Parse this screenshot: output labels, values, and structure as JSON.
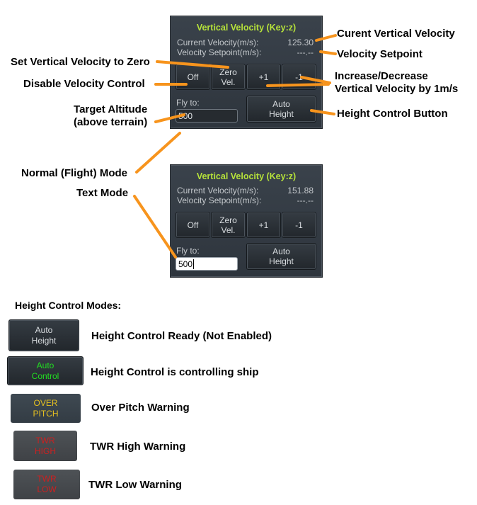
{
  "panel1": {
    "title": "Vertical Velocity (Key:z)",
    "current_velocity_label": "Current Velocity(m/s):",
    "current_velocity_value": "125.30",
    "setpoint_label": "Velocity Setpoint(m/s):",
    "setpoint_value": "---.--",
    "buttons": {
      "off": "Off",
      "zero_line1": "Zero",
      "zero_line2": "Vel.",
      "plus": "+1",
      "minus": "-1"
    },
    "fly_to_label": "Fly to:",
    "fly_to_value": "500",
    "auto_height_line1": "Auto",
    "auto_height_line2": "Height"
  },
  "panel2": {
    "title": "Vertical Velocity (Key:z)",
    "current_velocity_label": "Current Velocity(m/s):",
    "current_velocity_value": "151.88",
    "setpoint_label": "Velocity Setpoint(m/s):",
    "setpoint_value": "---.--",
    "buttons": {
      "off": "Off",
      "zero_line1": "Zero",
      "zero_line2": "Vel.",
      "plus": "+1",
      "minus": "-1"
    },
    "fly_to_label": "Fly to:",
    "fly_to_value": "500",
    "auto_height_line1": "Auto",
    "auto_height_line2": "Height"
  },
  "callouts": {
    "current_velocity": "Curent Vertical Velocity",
    "setpoint": "Velocity Setpoint",
    "zero": "Set Vertical Velocity to Zero",
    "disable": "Disable Velocity Control",
    "inc_dec_line1": "Increase/Decrease",
    "inc_dec_line2": "Vertical Velocity by 1m/s",
    "target_alt_line1": "Target Altitude",
    "target_alt_line2": "(above terrain)",
    "height_button": "Height Control Button",
    "normal_mode": "Normal (Flight) Mode",
    "text_mode": "Text Mode"
  },
  "modes": {
    "heading": "Height Control Modes:",
    "items": [
      {
        "line1": "Auto",
        "line2": "Height",
        "desc": "Height Control Ready (Not Enabled)",
        "text_color": "#d8dcdf"
      },
      {
        "line1": "Auto",
        "line2": "Control",
        "desc": "Height Control is controlling ship",
        "text_color": "#22dd22"
      },
      {
        "line1": "OVER",
        "line2": "PITCH",
        "desc": "Over Pitch Warning",
        "text_color": "#e5c020"
      },
      {
        "line1": "TWR",
        "line2": "HIGH",
        "desc": "TWR High Warning",
        "text_color": "#cc2020"
      },
      {
        "line1": "TWR",
        "line2": "LOW",
        "desc": "TWR Low Warning",
        "text_color": "#cc2020"
      }
    ]
  },
  "colors": {
    "accent_title": "#b6e23a",
    "arrow": "#f7941d"
  }
}
